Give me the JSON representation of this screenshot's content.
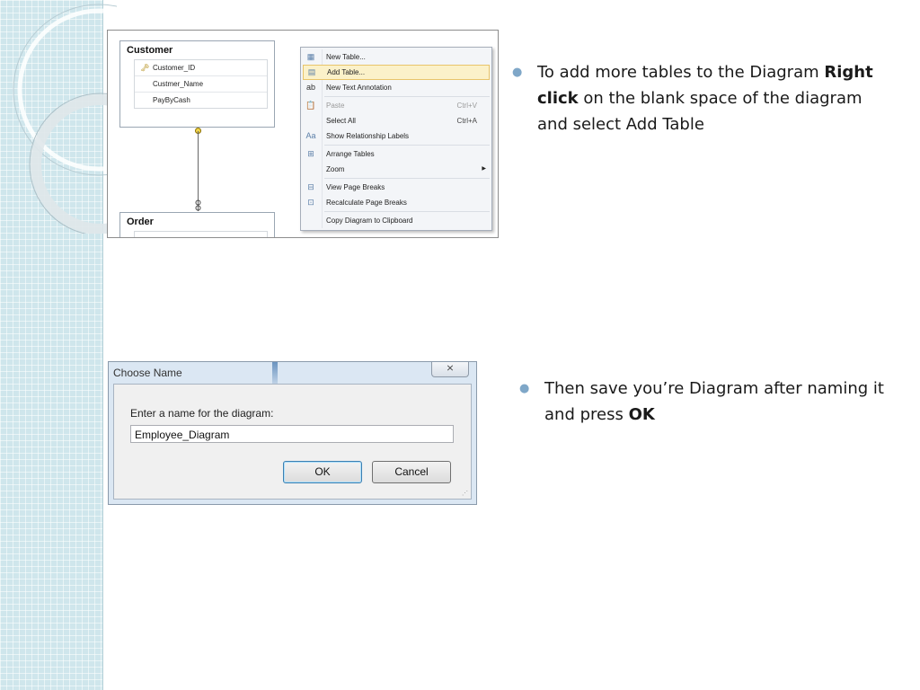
{
  "diagram": {
    "tables": [
      {
        "title": "Customer",
        "rows": [
          "Customer_ID",
          "Custmer_Name",
          "PayByCash"
        ]
      },
      {
        "title": "Order",
        "rows": []
      }
    ]
  },
  "context_menu": {
    "items": [
      {
        "label": "New Table...",
        "shortcut": "",
        "icon": "new-table-icon"
      },
      {
        "label": "Add Table...",
        "shortcut": "",
        "icon": "add-table-icon"
      },
      {
        "label": "New Text Annotation",
        "shortcut": "",
        "icon": "text-annotation-icon"
      },
      {
        "label": "Paste",
        "shortcut": "Ctrl+V",
        "icon": "paste-icon"
      },
      {
        "label": "Select All",
        "shortcut": "Ctrl+A",
        "icon": ""
      },
      {
        "label": "Show Relationship Labels",
        "shortcut": "",
        "icon": "relationship-labels-icon"
      },
      {
        "label": "Arrange Tables",
        "shortcut": "",
        "icon": "arrange-tables-icon"
      },
      {
        "label": "Zoom",
        "shortcut": "",
        "icon": ""
      },
      {
        "label": "View Page Breaks",
        "shortcut": "",
        "icon": "page-breaks-icon"
      },
      {
        "label": "Recalculate Page Breaks",
        "shortcut": "",
        "icon": "recalculate-icon"
      },
      {
        "label": "Copy Diagram to Clipboard",
        "shortcut": "",
        "icon": ""
      }
    ]
  },
  "bullets": [
    {
      "text_1": "To add more tables to the Diagram",
      "bold": "Right click",
      "text_2": "on the blank space of the diagram and select Add Table"
    },
    {
      "text_1": "Then save you’re Diagram after naming it and press",
      "bold": "OK"
    }
  ],
  "dialog": {
    "title": "Choose Name",
    "close_glyph": "⨯",
    "prompt": "Enter a name for the diagram:",
    "input_value": "Employee_Diagram",
    "ok_label": "OK",
    "cancel_label": "Cancel"
  },
  "colors": {
    "menu_highlight": "#fbf1c9",
    "bullet": "#7fa7c8",
    "strip": "#cfe6ec"
  }
}
